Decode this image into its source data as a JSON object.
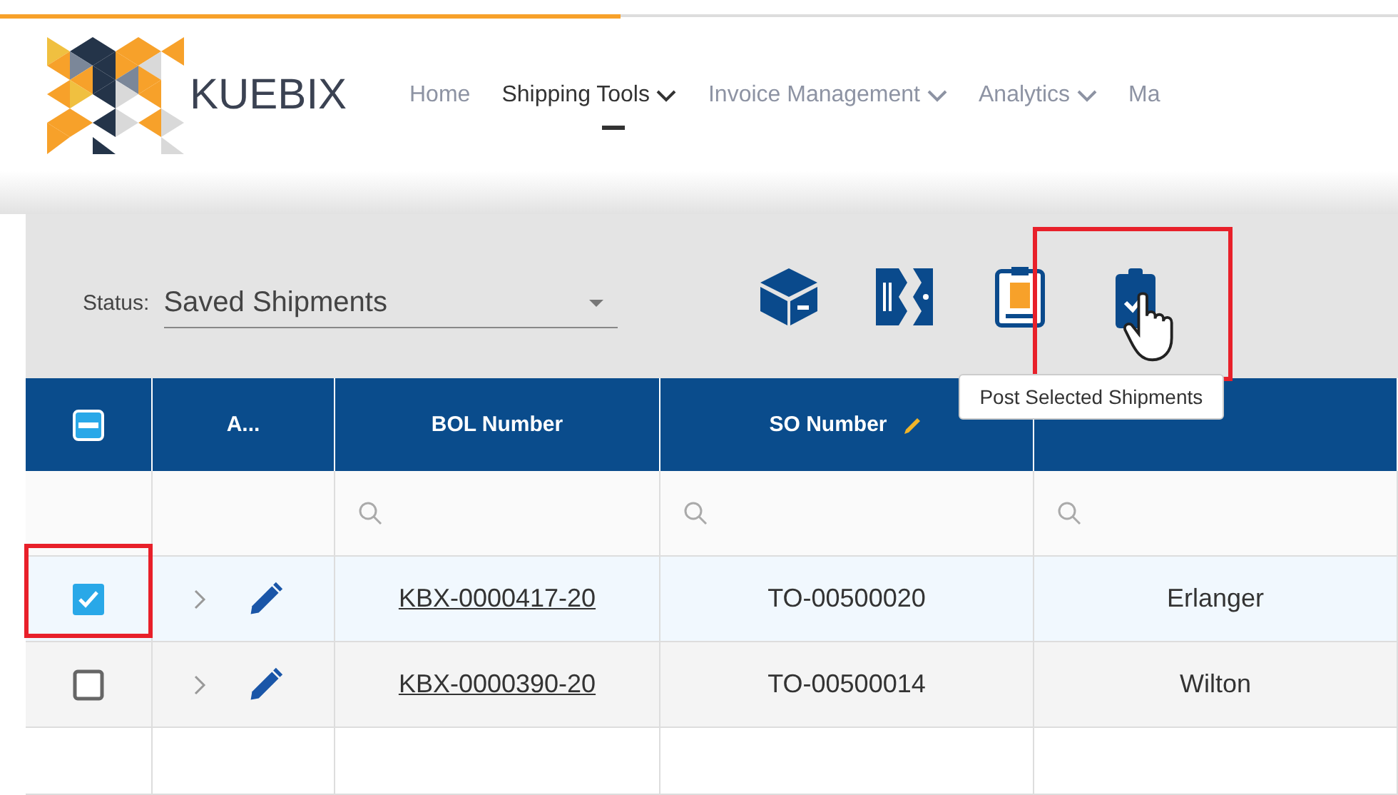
{
  "brand": {
    "name": "KUEBIX"
  },
  "nav": [
    {
      "label": "Home",
      "selected": false,
      "dropdown": false
    },
    {
      "label": "Shipping Tools",
      "selected": true,
      "dropdown": true
    },
    {
      "label": "Invoice Management",
      "selected": false,
      "dropdown": true
    },
    {
      "label": "Analytics",
      "selected": false,
      "dropdown": true
    },
    {
      "label": "Ma",
      "selected": false,
      "dropdown": false
    }
  ],
  "toolbar": {
    "status_label": "Status:",
    "status_value": "Saved Shipments",
    "actions": [
      {
        "kind": "box",
        "highlighted": false
      },
      {
        "kind": "ticket",
        "highlighted": false
      },
      {
        "kind": "invoice",
        "highlighted": false
      },
      {
        "kind": "post",
        "highlighted": true
      }
    ],
    "tooltip": "Post Selected Shipments"
  },
  "table": {
    "header_checkbox": {
      "indeterminate": true
    },
    "columns": [
      {
        "label": "A...",
        "editable": false
      },
      {
        "label": "BOL Number",
        "editable": false
      },
      {
        "label": "SO Number",
        "editable": true
      },
      {
        "editable": false
      }
    ],
    "rows": [
      {
        "checked": true,
        "highlighted": true,
        "bol": "KBX-0000417-20",
        "so": "TO-00500020",
        "column_5": "Erlanger"
      },
      {
        "checked": false,
        "highlighted": false,
        "bol": "KBX-0000390-20",
        "so": "TO-00500014",
        "column_5": "Wilton"
      }
    ]
  }
}
